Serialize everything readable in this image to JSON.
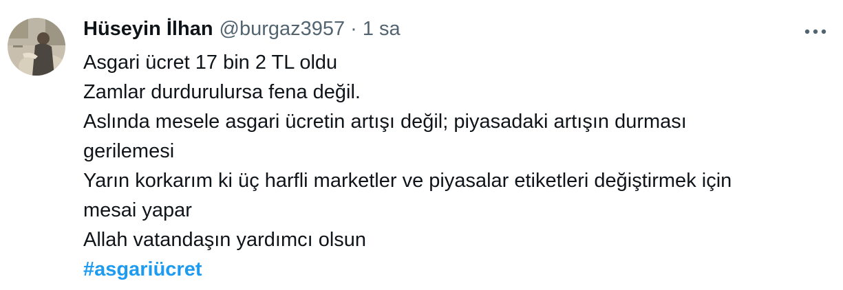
{
  "tweet": {
    "author_name": "Hüseyin İlhan",
    "handle": "@burgaz3957",
    "separator": "·",
    "time": "1 sa",
    "more_icon": "more-horizontal-icon",
    "lines": [
      "Asgari ücret 17 bin 2 TL oldu",
      "Zamlar durdurulursa fena değil.",
      "Aslında mesele asgari ücretin artışı değil; piyasadaki artışın durması",
      "gerilemesi",
      "Yarın korkarım ki üç harfli marketler ve piyasalar etiketleri değiştirmek için",
      "mesai yapar",
      "Allah vatandaşın yardımcı olsun"
    ],
    "hashtag": "#asgariücret"
  },
  "colors": {
    "text": "#0f1419",
    "muted": "#536471",
    "link": "#1d9bf0",
    "background": "#ffffff"
  }
}
